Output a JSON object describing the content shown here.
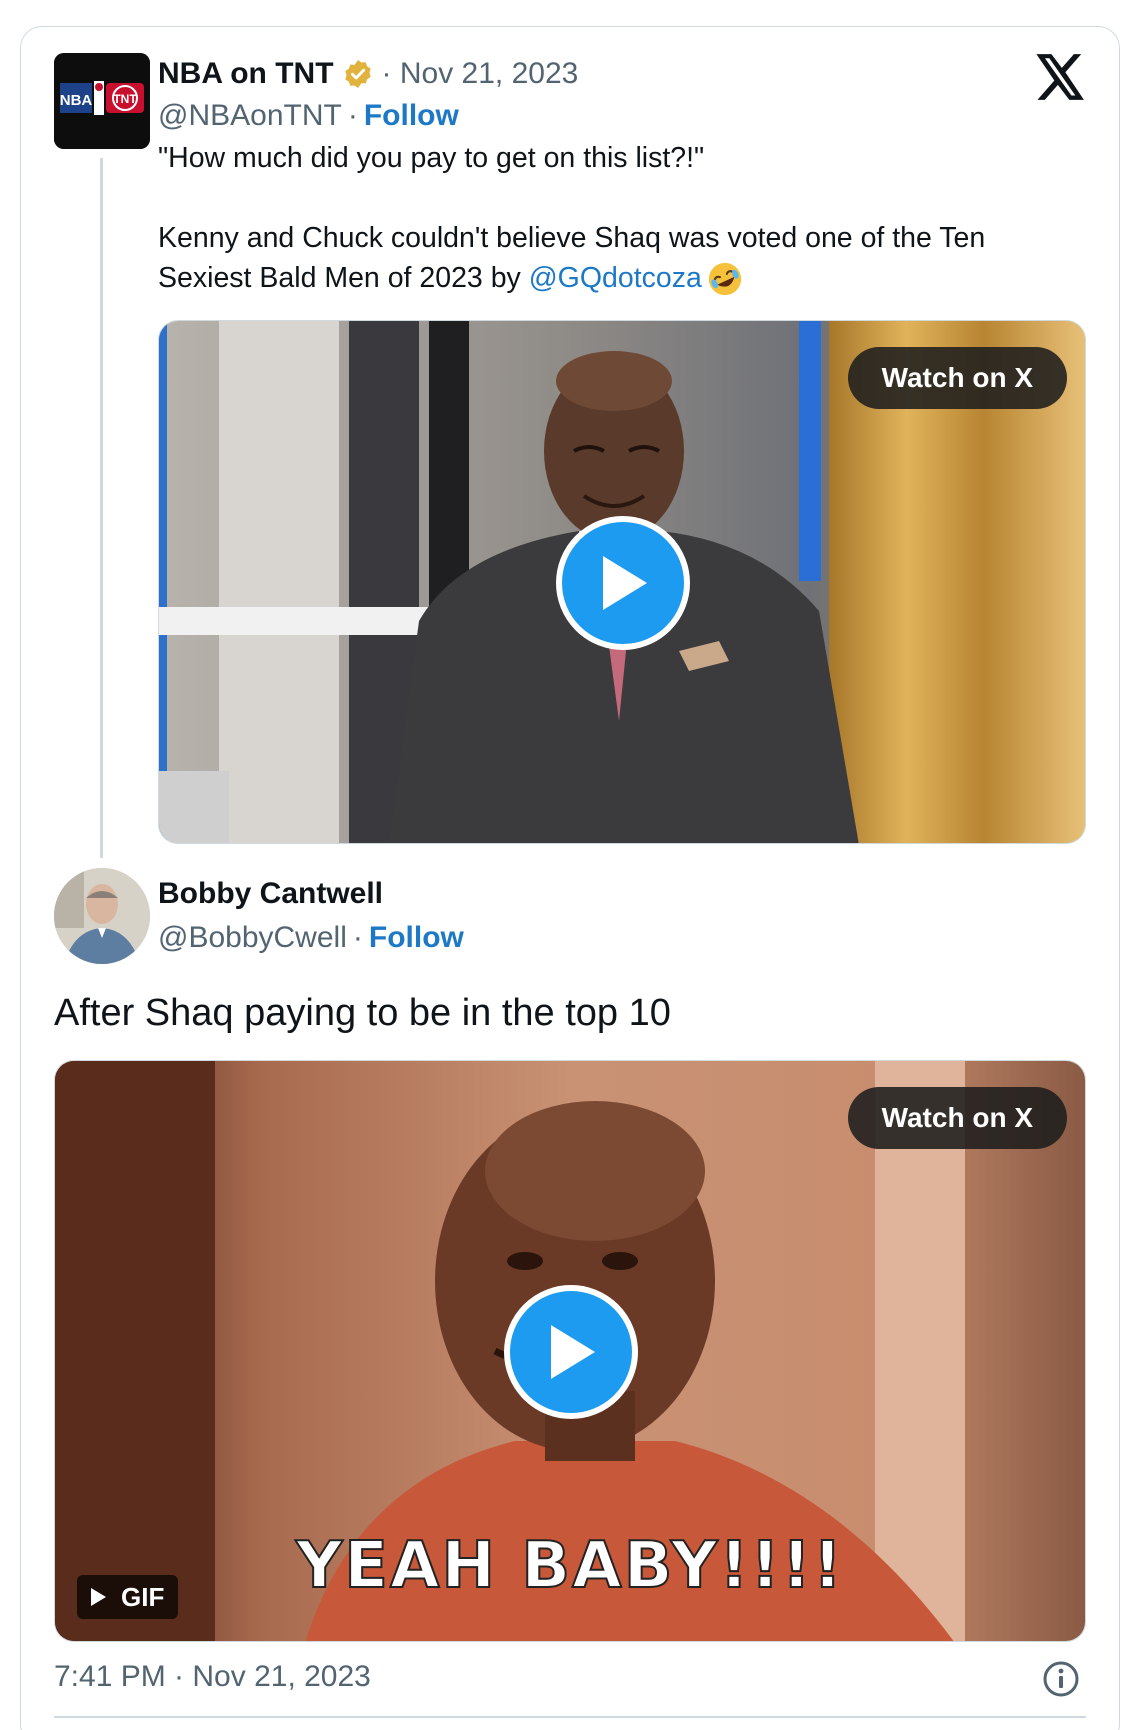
{
  "parent_tweet": {
    "display_name": "NBA on TNT",
    "verified": true,
    "date": "· Nov 21, 2023",
    "handle": "@NBAonTNT",
    "separator": "·",
    "follow_label": "Follow",
    "avatar_logo_left": "NBA",
    "avatar_logo_right": "TNT",
    "text_line1": "\"How much did you pay to get on this list?!\"",
    "text_line2": "Kenny and Chuck couldn't believe Shaq was voted one of the Ten",
    "text_line3_prefix": "Sexiest Bald Men of 2023 by ",
    "mention": "@GQdotcoza",
    "emoji_icon": "rolling-on-floor-laughing-emoji",
    "media": {
      "watch_label": "Watch on X",
      "play_icon": "play-icon"
    }
  },
  "reply_tweet": {
    "display_name": "Bobby Cantwell",
    "handle": "@BobbyCwell",
    "separator": "·",
    "follow_label": "Follow",
    "text": "After Shaq paying to be in the top 10",
    "media": {
      "watch_label": "Watch on X",
      "play_icon": "play-icon",
      "gif_badge": "GIF",
      "caption": "YEAH BABY!!!!"
    },
    "timestamp": "7:41 PM · Nov 21, 2023"
  },
  "colors": {
    "link": "#1d79c6",
    "muted": "#536471",
    "play": "#1d9bf0",
    "border": "#cfd9de"
  }
}
